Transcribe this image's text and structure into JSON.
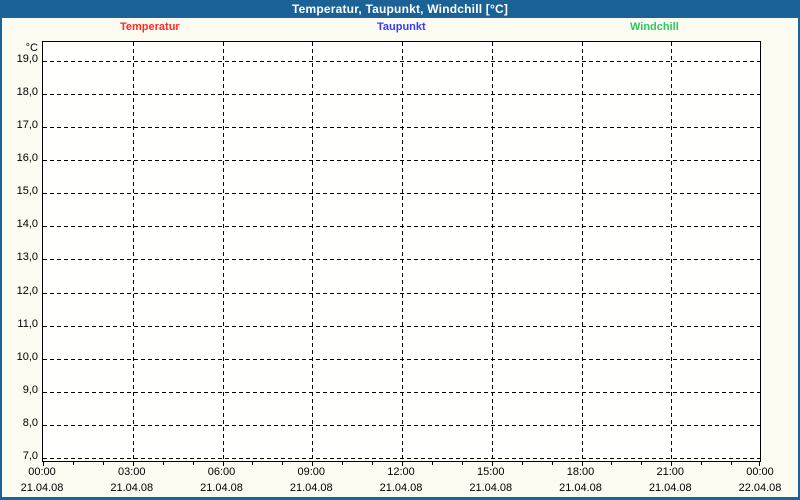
{
  "window": {
    "title": "Temperatur, Taupunkt, Windchill [°C]"
  },
  "legend": {
    "items": [
      {
        "label": "Temperatur",
        "color": "#ff2a24"
      },
      {
        "label": "Taupunkt",
        "color": "#3a3aff"
      },
      {
        "label": "Windchill",
        "color": "#2cc95f"
      }
    ]
  },
  "chart_data": {
    "type": "line",
    "title": "Temperatur, Taupunkt, Windchill [°C]",
    "ylabel": "°C",
    "xlabel": "",
    "ylim": [
      7.0,
      19.0
    ],
    "y_tick_labels": [
      "19,0",
      "18,0",
      "17,0",
      "16,0",
      "15,0",
      "14,0",
      "13,0",
      "12,0",
      "11,0",
      "10,0",
      "9,0",
      "8,0",
      "7,0"
    ],
    "y_tick_values": [
      19.0,
      18.0,
      17.0,
      16.0,
      15.0,
      14.0,
      13.0,
      12.0,
      11.0,
      10.0,
      9.0,
      8.0,
      7.0
    ],
    "x_ticks": [
      {
        "time": "00:00",
        "date": "21.04.08"
      },
      {
        "time": "03:00",
        "date": "21.04.08"
      },
      {
        "time": "06:00",
        "date": "21.04.08"
      },
      {
        "time": "09:00",
        "date": "21.04.08"
      },
      {
        "time": "12:00",
        "date": "21.04.08"
      },
      {
        "time": "15:00",
        "date": "21.04.08"
      },
      {
        "time": "18:00",
        "date": "21.04.08"
      },
      {
        "time": "21:00",
        "date": "21.04.08"
      },
      {
        "time": "00:00",
        "date": "22.04.08"
      }
    ],
    "minor_x_ticks_per_major_interval": 2,
    "grid": "dashed",
    "legend_position": "top",
    "series": [
      {
        "name": "Temperatur",
        "color": "#ff2a24",
        "values": []
      },
      {
        "name": "Taupunkt",
        "color": "#3a3aff",
        "values": []
      },
      {
        "name": "Windchill",
        "color": "#2cc95f",
        "values": []
      }
    ]
  },
  "colors": {
    "titlebar": "#1b6296",
    "frame": "#1b6296",
    "content_background": "#fbfbf2",
    "plot_background": "#fffffe",
    "grid": "#000000"
  }
}
